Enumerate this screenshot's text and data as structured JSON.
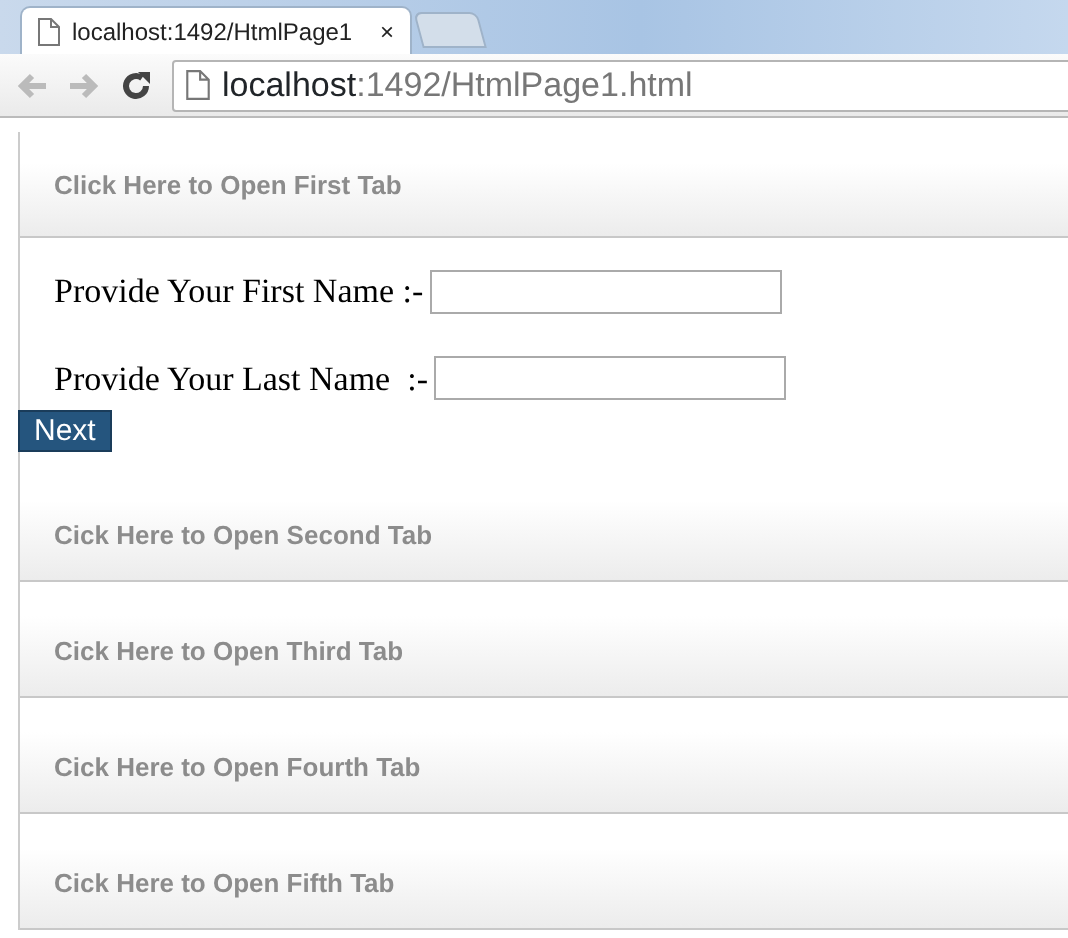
{
  "browser": {
    "tab_title": "localhost:1492/HtmlPage1",
    "close_glyph": "×",
    "address_host": "localhost",
    "address_rest": ":1492/HtmlPage1.html"
  },
  "accordion": [
    {
      "header": "Click Here to Open First Tab",
      "fields": [
        {
          "label": "Provide Your First Name :-"
        },
        {
          "label": "Provide Your Last Name  :-"
        }
      ],
      "button": "Next"
    },
    {
      "header": "Cick Here to Open Second Tab"
    },
    {
      "header": "Cick Here to Open Third Tab"
    },
    {
      "header": "Cick Here to Open Fourth Tab"
    },
    {
      "header": "Cick Here to Open Fifth Tab"
    }
  ]
}
